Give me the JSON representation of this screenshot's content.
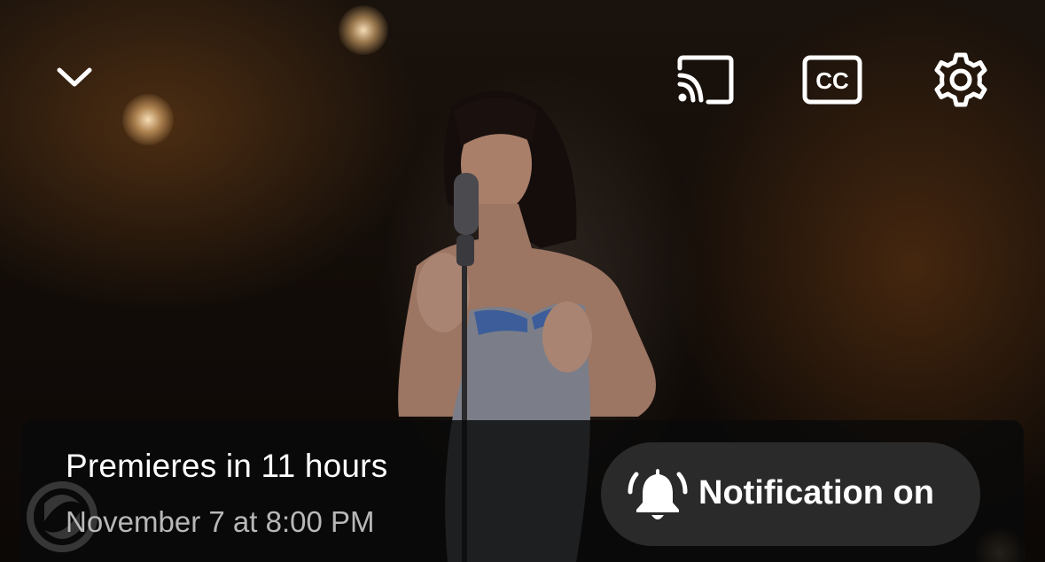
{
  "player": {
    "collapse_icon": "chevron-down-icon",
    "cast_icon": "cast-icon",
    "captions_icon": "closed-captions-icon",
    "captions_label": "CC",
    "settings_icon": "gear-icon"
  },
  "premiere": {
    "title": "Premieres in 11 hours",
    "date": "November 7 at 8:00 PM",
    "notification_label": "Notification on",
    "notification_icon": "bell-ringing-icon"
  },
  "colors": {
    "card_background": "#0a0a0a",
    "pill_background": "#2a2a2a",
    "primary_text": "#ffffff",
    "secondary_text": "#b8b8b8"
  }
}
